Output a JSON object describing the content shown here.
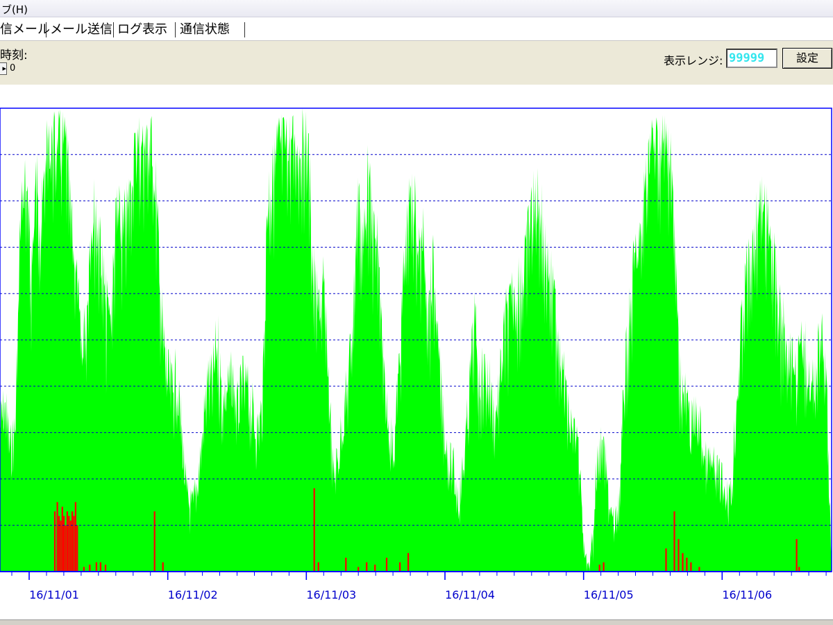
{
  "menu": {
    "help": "ブ(H)"
  },
  "toolbar": {
    "tabs": [
      {
        "label": "信メール"
      },
      {
        "label": "メール送信"
      },
      {
        "label": "ログ表示"
      },
      {
        "label": "通信状態"
      }
    ]
  },
  "controls": {
    "time_label": "時刻:",
    "spin_value": "0",
    "range_label": "表示レンジ:",
    "range_value": "99999",
    "set_button": "設定"
  },
  "colors": {
    "series_total": "#00ff00",
    "series_red": "#ff0000",
    "axis": "#0000ff",
    "grid": "#0000cc",
    "tick_label": "#0000cc"
  },
  "chart_data": {
    "type": "bar",
    "x_tick_labels": [
      "16/11/01",
      "16/11/02",
      "16/11/03",
      "16/11/04",
      "16/11/05",
      "16/11/06"
    ],
    "grid": true,
    "y_gridlines": 10,
    "series": [
      {
        "envelope": [
          [
            0,
            0.38
          ],
          [
            0.006,
            0.42
          ],
          [
            0.012,
            0.32
          ],
          [
            0.018,
            0.37
          ],
          [
            0.024,
            0.82
          ],
          [
            0.03,
            0.94
          ],
          [
            0.037,
            0.72
          ],
          [
            0.043,
            0.93
          ],
          [
            0.049,
            0.83
          ],
          [
            0.055,
            0.97
          ],
          [
            0.061,
            1.0
          ],
          [
            0.067,
            1.0
          ],
          [
            0.073,
            1.0
          ],
          [
            0.079,
            1.0
          ],
          [
            0.085,
            0.83
          ],
          [
            0.091,
            0.73
          ],
          [
            0.097,
            0.55
          ],
          [
            0.103,
            0.62
          ],
          [
            0.109,
            0.85
          ],
          [
            0.115,
            0.86
          ],
          [
            0.121,
            0.77
          ],
          [
            0.127,
            0.64
          ],
          [
            0.133,
            0.64
          ],
          [
            0.14,
            0.86
          ],
          [
            0.146,
            0.81
          ],
          [
            0.152,
            0.85
          ],
          [
            0.158,
            0.93
          ],
          [
            0.164,
            1.0
          ],
          [
            0.17,
            1.0
          ],
          [
            0.176,
            1.0
          ],
          [
            0.182,
            1.0
          ],
          [
            0.188,
            0.87
          ],
          [
            0.194,
            0.62
          ],
          [
            0.2,
            0.5
          ],
          [
            0.206,
            0.46
          ],
          [
            0.212,
            0.49
          ],
          [
            0.218,
            0.36
          ],
          [
            0.224,
            0.21
          ],
          [
            0.231,
            0.18
          ],
          [
            0.237,
            0.24
          ],
          [
            0.243,
            0.35
          ],
          [
            0.249,
            0.48
          ],
          [
            0.255,
            0.47
          ],
          [
            0.261,
            0.58
          ],
          [
            0.267,
            0.43
          ],
          [
            0.273,
            0.46
          ],
          [
            0.279,
            0.48
          ],
          [
            0.285,
            0.41
          ],
          [
            0.291,
            0.47
          ],
          [
            0.297,
            0.46
          ],
          [
            0.303,
            0.41
          ],
          [
            0.309,
            0.36
          ],
          [
            0.315,
            0.42
          ],
          [
            0.321,
            0.89
          ],
          [
            0.327,
            0.92
          ],
          [
            0.333,
            1.0
          ],
          [
            0.339,
            1.0
          ],
          [
            0.346,
            1.0
          ],
          [
            0.352,
            1.0
          ],
          [
            0.358,
            1.0
          ],
          [
            0.364,
            1.0
          ],
          [
            0.37,
            1.0
          ],
          [
            0.376,
            0.73
          ],
          [
            0.382,
            0.63
          ],
          [
            0.388,
            0.7
          ],
          [
            0.394,
            0.51
          ],
          [
            0.4,
            0.25
          ],
          [
            0.406,
            0.3
          ],
          [
            0.412,
            0.39
          ],
          [
            0.418,
            0.47
          ],
          [
            0.424,
            0.64
          ],
          [
            0.43,
            0.91
          ],
          [
            0.436,
            0.78
          ],
          [
            0.442,
            0.93
          ],
          [
            0.448,
            0.82
          ],
          [
            0.455,
            0.76
          ],
          [
            0.461,
            0.47
          ],
          [
            0.467,
            0.37
          ],
          [
            0.473,
            0.32
          ],
          [
            0.479,
            0.49
          ],
          [
            0.485,
            0.73
          ],
          [
            0.491,
            0.85
          ],
          [
            0.497,
            0.89
          ],
          [
            0.503,
            0.77
          ],
          [
            0.509,
            0.79
          ],
          [
            0.515,
            0.66
          ],
          [
            0.521,
            0.73
          ],
          [
            0.527,
            0.52
          ],
          [
            0.533,
            0.39
          ],
          [
            0.539,
            0.29
          ],
          [
            0.545,
            0.27
          ],
          [
            0.551,
            0.2
          ],
          [
            0.557,
            0.28
          ],
          [
            0.564,
            0.45
          ],
          [
            0.57,
            0.63
          ],
          [
            0.576,
            0.47
          ],
          [
            0.582,
            0.5
          ],
          [
            0.588,
            0.48
          ],
          [
            0.594,
            0.39
          ],
          [
            0.6,
            0.46
          ],
          [
            0.606,
            0.6
          ],
          [
            0.612,
            0.64
          ],
          [
            0.618,
            0.67
          ],
          [
            0.624,
            0.71
          ],
          [
            0.63,
            0.72
          ],
          [
            0.636,
            0.84
          ],
          [
            0.642,
            0.87
          ],
          [
            0.648,
            0.89
          ],
          [
            0.654,
            0.79
          ],
          [
            0.66,
            0.72
          ],
          [
            0.666,
            0.66
          ],
          [
            0.673,
            0.57
          ],
          [
            0.679,
            0.46
          ],
          [
            0.685,
            0.37
          ],
          [
            0.691,
            0.36
          ],
          [
            0.697,
            0.26
          ],
          [
            0.703,
            0.05
          ],
          [
            0.709,
            0.02
          ],
          [
            0.715,
            0.22
          ],
          [
            0.721,
            0.32
          ],
          [
            0.727,
            0.29
          ],
          [
            0.733,
            0.18
          ],
          [
            0.739,
            0.13
          ],
          [
            0.745,
            0.22
          ],
          [
            0.751,
            0.5
          ],
          [
            0.757,
            0.63
          ],
          [
            0.763,
            0.76
          ],
          [
            0.77,
            0.78
          ],
          [
            0.776,
            0.94
          ],
          [
            0.782,
            1.0
          ],
          [
            0.788,
            1.0
          ],
          [
            0.794,
            1.0
          ],
          [
            0.8,
            1.0
          ],
          [
            0.806,
            1.0
          ],
          [
            0.812,
            0.73
          ],
          [
            0.818,
            0.47
          ],
          [
            0.824,
            0.44
          ],
          [
            0.83,
            0.37
          ],
          [
            0.836,
            0.39
          ],
          [
            0.842,
            0.37
          ],
          [
            0.848,
            0.28
          ],
          [
            0.854,
            0.29
          ],
          [
            0.86,
            0.26
          ],
          [
            0.866,
            0.25
          ],
          [
            0.872,
            0.22
          ],
          [
            0.879,
            0.21
          ],
          [
            0.885,
            0.43
          ],
          [
            0.891,
            0.6
          ],
          [
            0.897,
            0.72
          ],
          [
            0.903,
            0.74
          ],
          [
            0.909,
            0.83
          ],
          [
            0.915,
            0.86
          ],
          [
            0.921,
            0.84
          ],
          [
            0.927,
            0.81
          ],
          [
            0.933,
            0.69
          ],
          [
            0.939,
            0.61
          ],
          [
            0.945,
            0.58
          ],
          [
            0.951,
            0.54
          ],
          [
            0.957,
            0.51
          ],
          [
            0.963,
            0.55
          ],
          [
            0.969,
            0.54
          ],
          [
            0.975,
            0.45
          ],
          [
            0.981,
            0.51
          ],
          [
            0.988,
            0.57
          ],
          [
            0.994,
            0.44
          ],
          [
            1.0,
            0.01
          ]
        ]
      },
      {
        "bursts": [
          [
            0.065,
            0.13
          ],
          [
            0.068,
            0.15
          ],
          [
            0.07,
            0.12
          ],
          [
            0.072,
            0.11
          ],
          [
            0.074,
            0.14
          ],
          [
            0.076,
            0.12
          ],
          [
            0.078,
            0.1
          ],
          [
            0.08,
            0.13
          ],
          [
            0.082,
            0.12
          ],
          [
            0.084,
            0.11
          ],
          [
            0.086,
            0.13
          ],
          [
            0.088,
            0.12
          ],
          [
            0.09,
            0.15
          ],
          [
            0.092,
            0.1
          ],
          [
            0.1,
            0.01
          ],
          [
            0.107,
            0.015
          ],
          [
            0.115,
            0.02
          ],
          [
            0.12,
            0.02
          ],
          [
            0.126,
            0.015
          ],
          [
            0.185,
            0.13
          ],
          [
            0.195,
            0.02
          ],
          [
            0.377,
            0.18
          ],
          [
            0.382,
            0.02
          ],
          [
            0.415,
            0.03
          ],
          [
            0.43,
            0.01
          ],
          [
            0.44,
            0.02
          ],
          [
            0.45,
            0.015
          ],
          [
            0.464,
            0.03
          ],
          [
            0.48,
            0.02
          ],
          [
            0.49,
            0.04
          ],
          [
            0.72,
            0.015
          ],
          [
            0.725,
            0.02
          ],
          [
            0.8,
            0.05
          ],
          [
            0.81,
            0.13
          ],
          [
            0.815,
            0.07
          ],
          [
            0.82,
            0.04
          ],
          [
            0.825,
            0.03
          ],
          [
            0.83,
            0.02
          ],
          [
            0.84,
            0.01
          ],
          [
            0.957,
            0.07
          ],
          [
            0.96,
            0.01
          ]
        ]
      }
    ]
  }
}
